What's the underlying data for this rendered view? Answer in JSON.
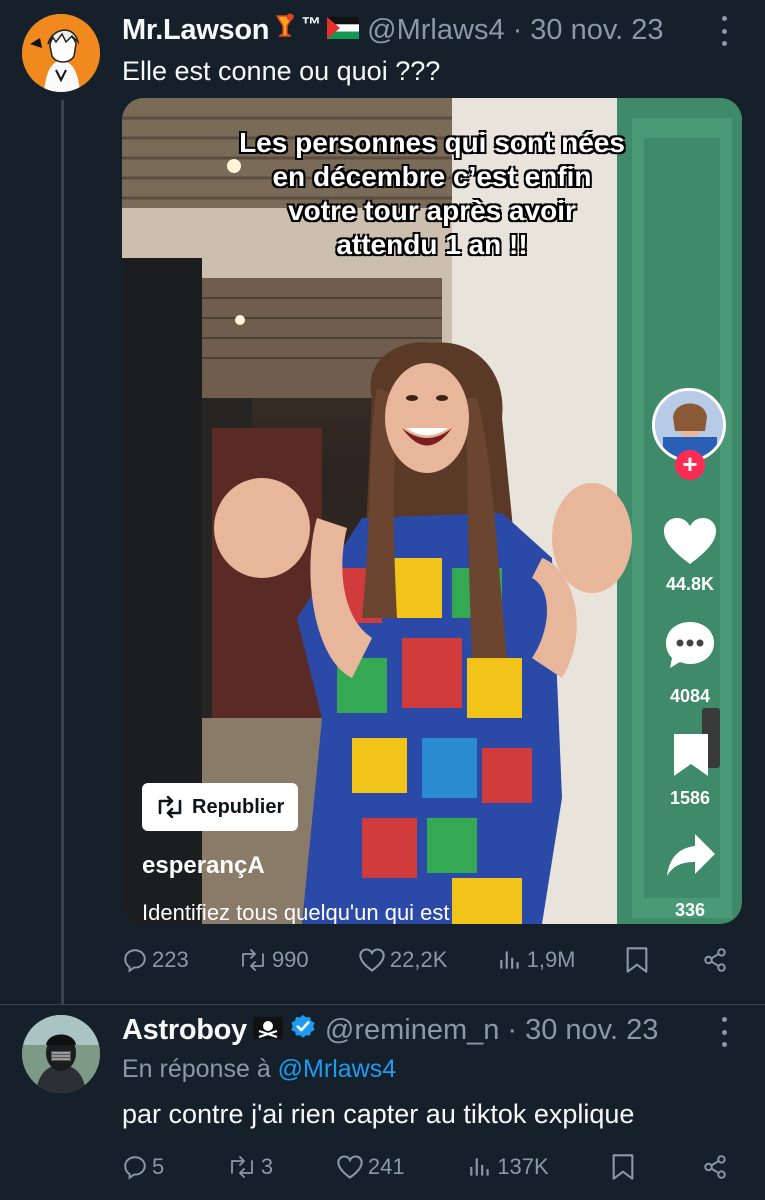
{
  "tweet1": {
    "name": "Mr.Lawson",
    "badge_suffix": "™",
    "handle": "@Mrlaws4",
    "separator": "·",
    "date": "30 nov. 23",
    "text": "Elle est conne ou quoi ???",
    "media": {
      "caption_lines": [
        "Les personnes qui sont nées",
        "en décembre c’est enfin",
        "votre tour après avoir",
        "attendu 1 an !!"
      ],
      "repost_label": "Republier",
      "creator": "esperançA",
      "description": "Identifiez tous quelqu'un qui est",
      "likes": "44.8K",
      "comments": "4084",
      "saves": "1586",
      "shares": "336"
    },
    "stats": {
      "replies": "223",
      "reposts": "990",
      "likes": "22,2K",
      "views": "1,9M"
    }
  },
  "tweet2": {
    "name": "Astroboy",
    "handle": "@reminem_n",
    "separator": "·",
    "date": "30 nov. 23",
    "reply_prefix": "En réponse à",
    "reply_to": "@Mrlaws4",
    "text": "par contre j'ai rien capter au tiktok explique",
    "stats": {
      "replies": "5",
      "reposts": "3",
      "likes": "241",
      "views": "137K"
    }
  },
  "colors": {
    "background": "#15202b",
    "secondary_text": "#8b98a5",
    "link": "#1d9bf0",
    "verified": "#1d9bf0",
    "tiktok_plus": "#fe2c55"
  }
}
